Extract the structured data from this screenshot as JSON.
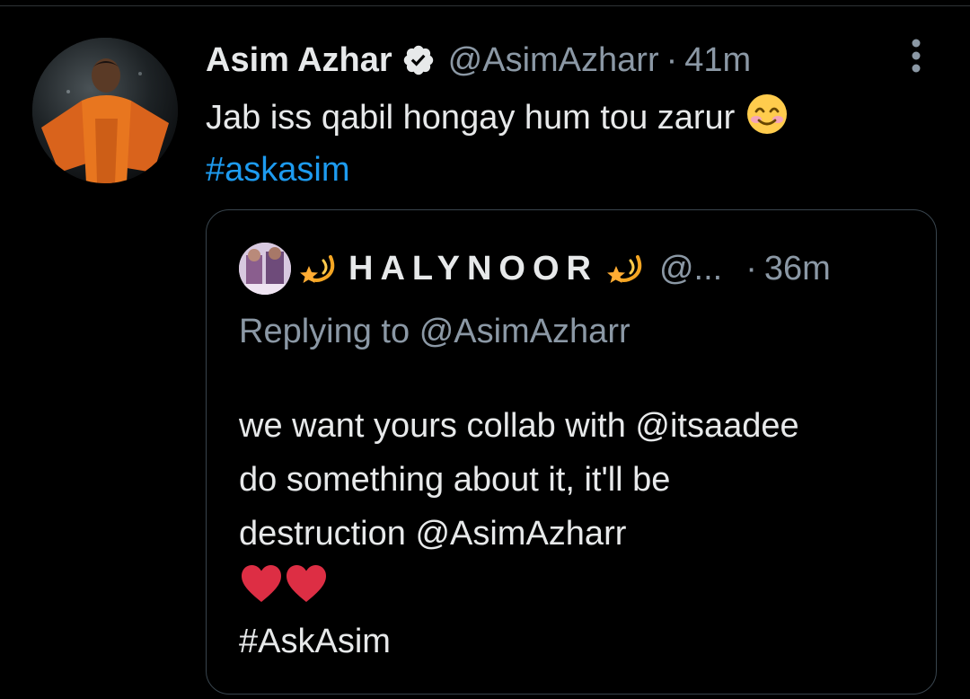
{
  "tweet": {
    "author_name": "Asim Azhar",
    "author_handle": "@AsimAzharr",
    "separator": "·",
    "time": "41m",
    "text": "Jab iss qabil hongay hum tou zarur",
    "hashtag": "#askasim",
    "verified": true,
    "icons": {
      "verified": "verified-badge-icon",
      "emoji": "smiling-face-with-smiling-eyes-emoji",
      "more": "more-options-icon"
    }
  },
  "quote": {
    "author_name": "HALYNOOR",
    "author_handle": "@...",
    "separator": "·",
    "time": "36m",
    "replying_prefix": "Replying to",
    "replying_to": "@AsimAzharr",
    "lines": [
      "we want yours collab with @itsaadee",
      "do something about it, it'll be",
      "destruction @AsimAzharr"
    ],
    "hashtag": "#AskAsim",
    "icons": {
      "name_decoration": "dizzy-star-emoji",
      "hearts": "red-heart-emoji"
    }
  },
  "colors": {
    "background": "#000000",
    "text_primary": "#e7e9ea",
    "text_secondary": "#8b98a5",
    "link": "#1d9bf0",
    "border": "#38444d",
    "verified_badge": "#e7e9ea",
    "heart": "#e0245e"
  }
}
